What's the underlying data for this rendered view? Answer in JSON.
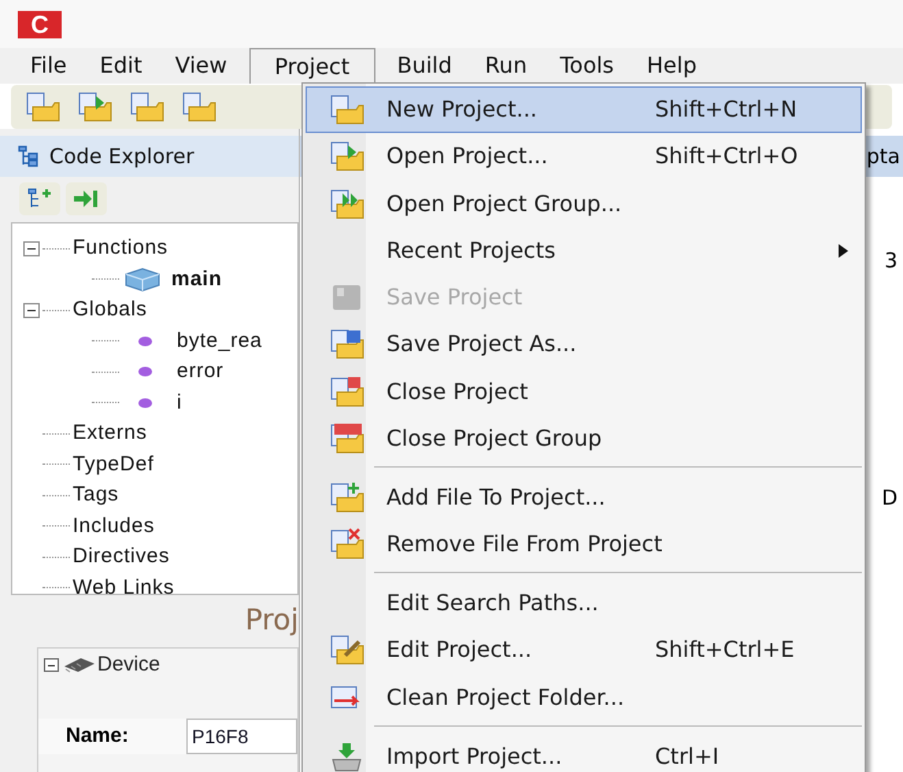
{
  "app_logo": "C",
  "menubar": [
    {
      "label": "File",
      "selected": false
    },
    {
      "label": "Edit",
      "selected": false
    },
    {
      "label": "View",
      "selected": false
    },
    {
      "label": "Project",
      "selected": true
    },
    {
      "label": "Build",
      "selected": false
    },
    {
      "label": "Run",
      "selected": false
    },
    {
      "label": "Tools",
      "selected": false
    },
    {
      "label": "Help",
      "selected": false
    }
  ],
  "code_explorer": {
    "title": "Code Explorer",
    "tree": [
      {
        "label": "Functions",
        "expanded": true,
        "children": [
          {
            "label": "main",
            "kind": "function"
          }
        ]
      },
      {
        "label": "Globals",
        "expanded": true,
        "children": [
          {
            "label": "byte_rea",
            "kind": "variable"
          },
          {
            "label": "error",
            "kind": "variable"
          },
          {
            "label": "i",
            "kind": "variable"
          }
        ]
      },
      {
        "label": "Externs"
      },
      {
        "label": "TypeDef"
      },
      {
        "label": "Tags"
      },
      {
        "label": "Includes"
      },
      {
        "label": "Directives"
      },
      {
        "label": "Web Links"
      }
    ]
  },
  "project_panel": {
    "title": "Proj",
    "group": {
      "title": "Device",
      "expanded": true
    },
    "name_label": "Name:",
    "name_value": "P16F8"
  },
  "editor": {
    "tab_fragment": "pta",
    "fragments": [
      "3",
      "D"
    ]
  },
  "project_menu": [
    {
      "kind": "item",
      "label": "New Project...",
      "shortcut": "Shift+Ctrl+N",
      "selected": true,
      "disabled": false
    },
    {
      "kind": "item",
      "label": "Open Project...",
      "shortcut": "Shift+Ctrl+O",
      "selected": false,
      "disabled": false
    },
    {
      "kind": "item",
      "label": "Open Project Group...",
      "selected": false,
      "disabled": false
    },
    {
      "kind": "item",
      "label": "Recent Projects",
      "submenu": true,
      "selected": false,
      "disabled": false
    },
    {
      "kind": "item",
      "label": "Save Project",
      "selected": false,
      "disabled": true
    },
    {
      "kind": "item",
      "label": "Save Project As...",
      "selected": false,
      "disabled": false
    },
    {
      "kind": "item",
      "label": "Close Project",
      "selected": false,
      "disabled": false
    },
    {
      "kind": "item",
      "label": "Close Project Group",
      "selected": false,
      "disabled": false
    },
    {
      "kind": "separator"
    },
    {
      "kind": "item",
      "label": "Add File To Project...",
      "selected": false,
      "disabled": false
    },
    {
      "kind": "item",
      "label": "Remove File From Project",
      "selected": false,
      "disabled": false
    },
    {
      "kind": "separator"
    },
    {
      "kind": "item",
      "label": "Edit Search Paths...",
      "selected": false,
      "disabled": false
    },
    {
      "kind": "item",
      "label": "Edit Project...",
      "shortcut": "Shift+Ctrl+E",
      "selected": false,
      "disabled": false
    },
    {
      "kind": "item",
      "label": "Clean Project Folder...",
      "selected": false,
      "disabled": false
    },
    {
      "kind": "separator"
    },
    {
      "kind": "item",
      "label": "Import Project...",
      "shortcut": "Ctrl+I",
      "selected": false,
      "disabled": false
    }
  ]
}
